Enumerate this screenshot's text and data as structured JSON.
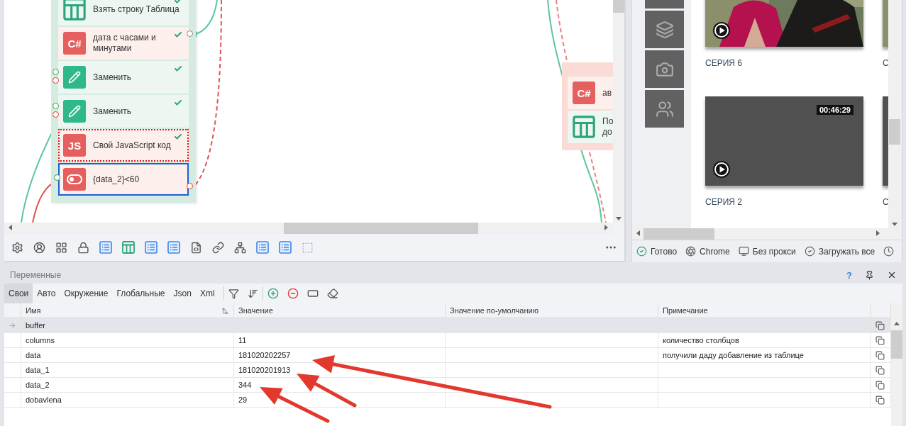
{
  "canvas": {
    "nodes": [
      {
        "kind": "table",
        "label": "Взять строку Таблица",
        "checked": true,
        "selected": false,
        "marked": false
      },
      {
        "kind": "csharp",
        "badge": "C#",
        "label": "дата с часами и минутами",
        "checked": true,
        "selected": false,
        "marked": false
      },
      {
        "kind": "edit",
        "label": "Заменить",
        "checked": true,
        "selected": false,
        "marked": false
      },
      {
        "kind": "edit",
        "label": "Заменить",
        "checked": true,
        "selected": false,
        "marked": false
      },
      {
        "kind": "js",
        "badge": "JS",
        "label": "Свой JavaScript код",
        "checked": true,
        "selected": false,
        "marked": true
      },
      {
        "kind": "condition",
        "label": "{data_2}<60",
        "checked": false,
        "selected": true,
        "marked": false
      }
    ],
    "side_nodes": [
      {
        "kind": "csharp",
        "badge": "C#",
        "label": "ав"
      },
      {
        "kind": "table",
        "label": "По до"
      }
    ]
  },
  "browser": {
    "videos": [
      {
        "kind": "picture",
        "title": "СЕРИЯ 6"
      },
      {
        "kind": "picture",
        "title": "С"
      },
      {
        "kind": "blank",
        "title": "СЕРИЯ 2",
        "duration": "00:46:29"
      },
      {
        "kind": "blank",
        "title": "С"
      }
    ],
    "status_bar": [
      {
        "label": "Готово"
      },
      {
        "label": "Chrome"
      },
      {
        "label": "Без прокси"
      },
      {
        "label": "Загружать все"
      }
    ]
  },
  "variables": {
    "title": "Переменные",
    "help": "?",
    "tabs": [
      {
        "label": "Свои",
        "selected": true
      },
      {
        "label": "Авто",
        "selected": false
      },
      {
        "label": "Окружение",
        "selected": false
      },
      {
        "label": "Глобальные",
        "selected": false
      },
      {
        "label": "Json",
        "selected": false
      },
      {
        "label": "Xml",
        "selected": false
      }
    ],
    "columns": [
      "Имя",
      "Значение",
      "Значение по-умолчанию",
      "Примечание"
    ],
    "rows": [
      {
        "name": "buffer",
        "selected": true
      },
      {
        "name": "columns",
        "value": "11",
        "note": "количество столбцов",
        "selected": false
      },
      {
        "name": "data",
        "value": "181020202257",
        "note": "получили даду добавление из таблице",
        "selected": false
      },
      {
        "name": "data_1",
        "value": "181020201913",
        "selected": false
      },
      {
        "name": "data_2",
        "value": "344",
        "selected": false
      },
      {
        "name": "dobavlena",
        "value": "29",
        "selected": false
      }
    ]
  }
}
